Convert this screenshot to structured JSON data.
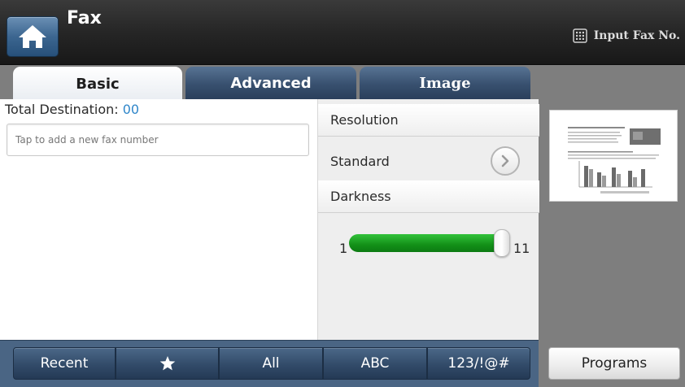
{
  "header": {
    "title": "Fax",
    "input_fax_label": "Input Fax No.",
    "home_icon": "home-icon",
    "keypad_icon": "keypad-icon"
  },
  "tabs": [
    {
      "label": "Basic",
      "active": true
    },
    {
      "label": "Advanced",
      "active": false
    },
    {
      "label": "Image",
      "active": false
    }
  ],
  "destination": {
    "label": "Total Destination: ",
    "count": "00",
    "input_placeholder": "Tap to add a new fax number",
    "input_value": ""
  },
  "settings": {
    "resolution_label": "Resolution",
    "resolution_value": "Standard",
    "darkness_label": "Darkness",
    "darkness_min": "1",
    "darkness_max": "11",
    "darkness_level": 11
  },
  "bottom_bar": {
    "recent": "Recent",
    "favorites_icon": "star-icon",
    "all": "All",
    "abc": "ABC",
    "symbols": "123/!@#"
  },
  "programs_label": "Programs",
  "colors": {
    "accent_blue": "#2f86c9",
    "slider_green": "#139018",
    "tab_navy": "#38506f"
  }
}
